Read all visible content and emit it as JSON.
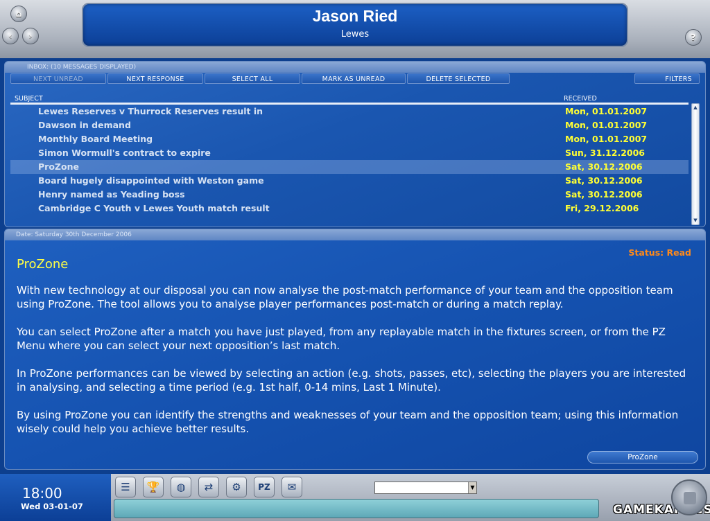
{
  "header": {
    "manager_name": "Jason Ried",
    "club_name": "Lewes",
    "help_glyph": "?"
  },
  "nav": {
    "home_icon": "home-icon",
    "back_icon": "back-arrow-icon",
    "forward_icon": "forward-arrow-icon"
  },
  "inbox": {
    "header_label": "INBOX: (10 MESSAGES DISPLAYED)",
    "toolbar": {
      "next_unread": "NEXT UNREAD",
      "next_response": "NEXT RESPONSE",
      "select_all": "SELECT ALL",
      "mark_as_unread": "MARK AS UNREAD",
      "delete_selected": "DELETE SELECTED",
      "filters": "FILTERS"
    },
    "columns": {
      "subject": "SUBJECT",
      "received": "RECEIVED"
    },
    "messages": [
      {
        "subject": "Lewes Reserves v Thurrock Reserves result in",
        "received": "Mon, 01.01.2007"
      },
      {
        "subject": "Dawson in demand",
        "received": "Mon, 01.01.2007"
      },
      {
        "subject": "Monthly Board Meeting",
        "received": "Mon, 01.01.2007"
      },
      {
        "subject": "Simon Wormull's contract to expire",
        "received": "Sun, 31.12.2006"
      },
      {
        "subject": "ProZone",
        "received": "Sat, 30.12.2006"
      },
      {
        "subject": "Board hugely disappointed with Weston game",
        "received": "Sat, 30.12.2006"
      },
      {
        "subject": "Henry named as Yeading boss",
        "received": "Sat, 30.12.2006"
      },
      {
        "subject": "Cambridge C Youth v Lewes Youth match result",
        "received": "Fri, 29.12.2006"
      }
    ]
  },
  "message": {
    "date_label": "Date: Saturday 30th December 2006",
    "status": "Status: Read",
    "title": "ProZone",
    "paragraphs": [
      "With new technology at our disposal you can now analyse the post-match performance of your team and the opposition team using ProZone. The tool allows you to analyse player performances post-match or during a match replay.",
      "You can select ProZone after a match you have just played, from any replayable match in the fixtures screen, or from the PZ Menu where you can select your next opposition’s last match.",
      "In ProZone performances can be viewed by selecting an action (e.g. shots, passes, etc), selecting the players you are interested in analysing, and selecting a time period (e.g. 1st half, 0-14 mins, Last 1 Minute).",
      "By using ProZone you can identify the strengths and weaknesses of your team and the opposition team; using this information wisely could help you achieve better results."
    ],
    "action_button": "ProZone"
  },
  "bottom": {
    "time": "18:00",
    "date": "Wed 03-01-07",
    "brand": "GAMEKAPOCS",
    "icons": [
      "menu-icon",
      "trophy-icon",
      "globe-icon",
      "transfer-icon",
      "gear-icon",
      "prozone-icon",
      "mail-icon"
    ],
    "prozone_glyph": "PZ"
  },
  "colors": {
    "panel_blue": "#1552b0",
    "date_yellow": "#ffff33",
    "status_orange": "#ff8a1a"
  }
}
